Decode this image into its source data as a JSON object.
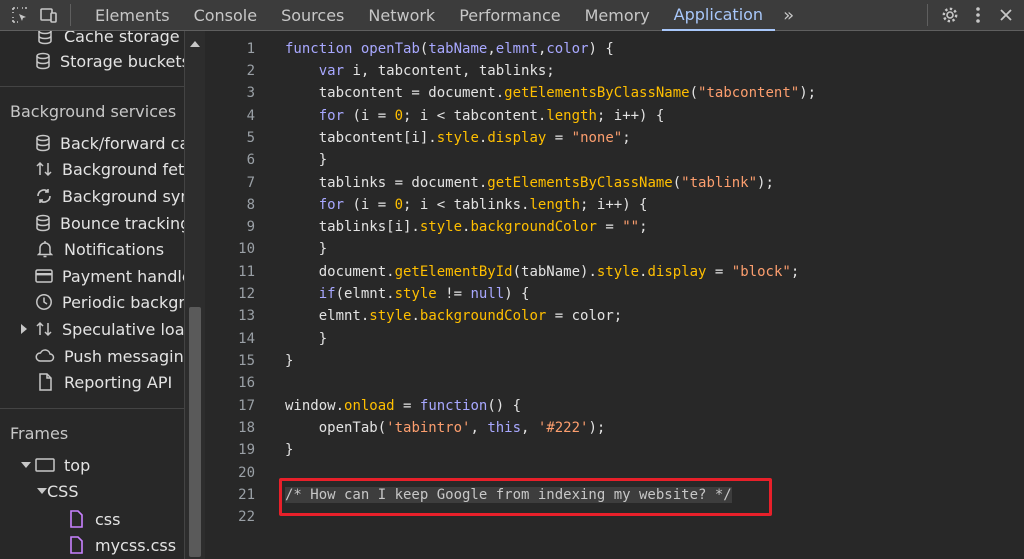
{
  "toolbar": {
    "tabs": [
      {
        "label": "Elements"
      },
      {
        "label": "Console"
      },
      {
        "label": "Sources"
      },
      {
        "label": "Network"
      },
      {
        "label": "Performance"
      },
      {
        "label": "Memory"
      },
      {
        "label": "Application"
      }
    ],
    "more_label": "»",
    "icons": [
      "inspect-element-icon",
      "device-toolbar-icon",
      "gear-icon",
      "more-vert-icon",
      "close-icon"
    ]
  },
  "sidebar": {
    "storage_items": [
      {
        "label": "Cache storage",
        "icon": "database-icon"
      },
      {
        "label": "Storage buckets",
        "icon": "database-icon"
      }
    ],
    "background_services_title": "Background services",
    "background_items": [
      {
        "label": "Back/forward cache",
        "icon": "database-icon"
      },
      {
        "label": "Background fetch",
        "icon": "sync-arrows-icon"
      },
      {
        "label": "Background sync",
        "icon": "refresh-icon"
      },
      {
        "label": "Bounce tracking mitigations",
        "icon": "database-icon"
      },
      {
        "label": "Notifications",
        "icon": "bell-icon"
      },
      {
        "label": "Payment handler",
        "icon": "card-icon"
      },
      {
        "label": "Periodic background sync",
        "icon": "clock-icon"
      },
      {
        "label": "Speculative loads",
        "icon": "sync-arrows-icon"
      },
      {
        "label": "Push messaging",
        "icon": "cloud-icon"
      },
      {
        "label": "Reporting API",
        "icon": "document-icon"
      }
    ],
    "frames_title": "Frames",
    "frames": [
      {
        "label": "top",
        "icon": "window-icon"
      },
      {
        "label": "CSS"
      },
      {
        "label": "css",
        "icon": "file-icon"
      },
      {
        "label": "mycss.css",
        "icon": "file-icon"
      }
    ]
  },
  "editor": {
    "lines": [
      "1",
      "2",
      "3",
      "4",
      "5",
      "6",
      "7",
      "8",
      "9",
      "10",
      "11",
      "12",
      "13",
      "14",
      "15",
      "16",
      "17",
      "18",
      "19",
      "20",
      "21",
      "22"
    ],
    "code": {
      "l1_kw": "function",
      "l1_fn": "openTab",
      "l1_params": "tabName",
      "l1_p2": "elmnt",
      "l1_p3": "color",
      "l1_rest": ") {",
      "l2_kw": "var",
      "l2_rest": " i, tabcontent, tablinks;",
      "l3_a": "tabcontent = document.",
      "l3_m": "getElementsByClassName",
      "l3_s": "\"tabcontent\"",
      "l4_kw": "for",
      "l4_a": " (i = ",
      "l4_n": "0",
      "l4_b": "; i < tabcontent.",
      "l4_p": "length",
      "l4_c": "; i++) {",
      "l5_a": "tabcontent[i].",
      "l5_p1": "style",
      "l5_p2": "display",
      "l5_s": "\"none\"",
      "l7_a": "tablinks = document.",
      "l7_m": "getElementsByClassName",
      "l7_s": "\"tablink\"",
      "l8_kw": "for",
      "l8_a": " (i = ",
      "l8_n": "0",
      "l8_b": "; i < tablinks.",
      "l8_p": "length",
      "l8_c": "; i++) {",
      "l9_a": "tablinks[i].",
      "l9_p1": "style",
      "l9_p2": "backgroundColor",
      "l9_s": "\"\"",
      "l11_a": "document.",
      "l11_m": "getElementById",
      "l11_b": "(tabName).",
      "l11_p1": "style",
      "l11_p2": "display",
      "l11_s": "\"block\"",
      "l12_kw": "if",
      "l12_a": "(elmnt.",
      "l12_p": "style",
      "l12_b": " != ",
      "l12_kw2": "null",
      "l12_c": ") {",
      "l13_a": "elmnt.",
      "l13_p1": "style",
      "l13_p2": "backgroundColor",
      "l13_b": " = color;",
      "l17_a": "window.",
      "l17_p": "onload",
      "l17_b": " = ",
      "l17_kw": "function",
      "l17_c": "() {",
      "l18_a": "openTab(",
      "l18_s1": "'tabintro'",
      "l18_kw": "this",
      "l18_s2": "'#222'",
      "l18_b": ");",
      "l21_cmt": "/* How can I keep Google from indexing my website? */"
    }
  },
  "colors": {
    "accent": "#a8c7fa",
    "highlight_border": "#e8202a"
  }
}
